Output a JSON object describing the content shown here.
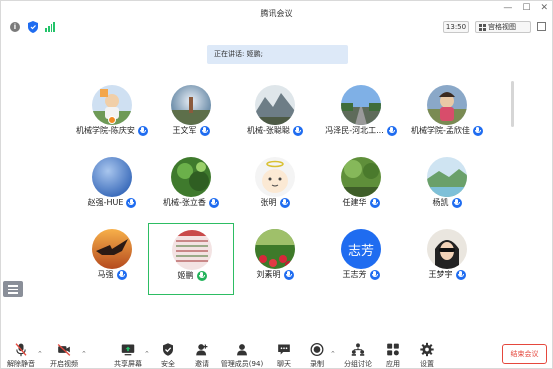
{
  "window": {
    "title": "腾讯会议"
  },
  "infobar": {
    "timer": "13:50",
    "view_label": "宫格视图"
  },
  "speaker_banner": "正在讲话: 姬鹏;",
  "participants": [
    {
      "name": "机械学院-陈庆安"
    },
    {
      "name": "王文军"
    },
    {
      "name": "机械-张聪聪"
    },
    {
      "name": "冯泽民-河北工..."
    },
    {
      "name": "机械学院-孟欣佳"
    },
    {
      "name": "赵强-HUE"
    },
    {
      "name": "机械-张立香"
    },
    {
      "name": "张明"
    },
    {
      "name": "任建华"
    },
    {
      "name": "杨凯"
    },
    {
      "name": "马强"
    },
    {
      "name": "姬鹏"
    },
    {
      "name": "刘素明"
    },
    {
      "name": "王志芳",
      "avatar_text": "志芳"
    },
    {
      "name": "王梦宇"
    }
  ],
  "toolbar": {
    "unmute": "解除静音",
    "start_video": "开启视频",
    "share_screen": "共享屏幕",
    "security": "安全",
    "invite": "邀请",
    "members": "管理成员(94)",
    "chat": "聊天",
    "record": "录制",
    "breakout": "分组讨论",
    "apps": "应用",
    "settings": "设置",
    "end_meeting": "结束会议"
  },
  "colors": {
    "accent_blue": "#1f6cf0",
    "speaking_green": "#22b35a",
    "end_red": "#e5483d",
    "banner_bg": "#dde9f8"
  }
}
